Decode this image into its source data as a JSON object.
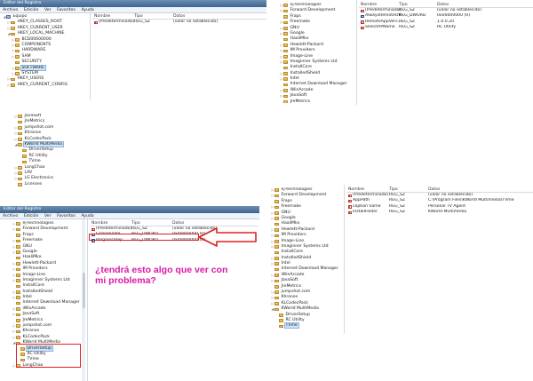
{
  "app": {
    "title": "Editor del Registro",
    "menu": [
      "Archivo",
      "Edición",
      "Ver",
      "Favoritos",
      "Ayuda"
    ]
  },
  "columns": {
    "name": "Nombre",
    "type": "Tipo",
    "data": "Datos"
  },
  "panel1": {
    "tree": [
      {
        "label": "Equipo",
        "level": 0,
        "icon": "computer",
        "expander": "◢"
      },
      {
        "label": "HKEY_CLASSES_ROOT",
        "level": 1,
        "icon": "folder",
        "expander": "▷"
      },
      {
        "label": "HKEY_CURRENT_USER",
        "level": 1,
        "icon": "folder",
        "expander": "▷"
      },
      {
        "label": "HKEY_LOCAL_MACHINE",
        "level": 1,
        "icon": "folder",
        "expander": "◢"
      },
      {
        "label": "BCD00000000",
        "level": 2,
        "icon": "folder",
        "expander": "▷"
      },
      {
        "label": "COMPONENTS",
        "level": 2,
        "icon": "folder",
        "expander": "▷"
      },
      {
        "label": "HARDWARE",
        "level": 2,
        "icon": "folder",
        "expander": "▷"
      },
      {
        "label": "SAM",
        "level": 2,
        "icon": "folder",
        "expander": "▷"
      },
      {
        "label": "SECURITY",
        "level": 2,
        "icon": "folder",
        "expander": ""
      },
      {
        "label": "SOFTWARE",
        "level": 2,
        "icon": "folder",
        "expander": "▷",
        "selected": true
      },
      {
        "label": "SYSTEM",
        "level": 2,
        "icon": "folder",
        "expander": "▷"
      },
      {
        "label": "HKEY_USERS",
        "level": 1,
        "icon": "folder",
        "expander": "▷"
      },
      {
        "label": "HKEY_CURRENT_CONFIG",
        "level": 1,
        "icon": "folder",
        "expander": "▷"
      }
    ],
    "values": [
      {
        "name": "(Predeterminado)",
        "type": "REG_SZ",
        "data": "(valor no establecido)",
        "kind": "sz"
      }
    ]
  },
  "panel2": {
    "tree": [
      {
        "label": "ej-technologies",
        "level": 0,
        "expander": "▷"
      },
      {
        "label": "Forward Development",
        "level": 0,
        "expander": "▷"
      },
      {
        "label": "Fraps",
        "level": 0,
        "expander": ""
      },
      {
        "label": "Freemake",
        "level": 0,
        "expander": "▷"
      },
      {
        "label": "GNU",
        "level": 0,
        "expander": "▷"
      },
      {
        "label": "Google",
        "level": 0,
        "expander": "▷"
      },
      {
        "label": "HaaliMkx",
        "level": 0,
        "expander": ""
      },
      {
        "label": "Hewlett-Packard",
        "level": 0,
        "expander": "▷"
      },
      {
        "label": "IM Providers",
        "level": 0,
        "expander": "▷"
      },
      {
        "label": "Image-Line",
        "level": 0,
        "expander": "▷"
      },
      {
        "label": "Imaginner Systems Ltd",
        "level": 0,
        "expander": "▷"
      },
      {
        "label": "InstallCore",
        "level": 0,
        "expander": ""
      },
      {
        "label": "InstalledShield",
        "level": 0,
        "expander": "▷"
      },
      {
        "label": "Intel",
        "level": 0,
        "expander": "▷"
      },
      {
        "label": "Internet Download Manager",
        "level": 0,
        "expander": ""
      },
      {
        "label": "iWinArcade",
        "level": 0,
        "expander": "▷"
      },
      {
        "label": "JavaSoft",
        "level": 0,
        "expander": "▷"
      },
      {
        "label": "JreMetrics",
        "level": 0,
        "expander": ""
      },
      {
        "label": "jumpshot.com",
        "level": 0,
        "expander": "▷"
      },
      {
        "label": "Khronos",
        "level": 0,
        "expander": "▷"
      },
      {
        "label": "KLCodecPack",
        "level": 0,
        "expander": "▷"
      },
      {
        "label": "KWorld MultiMedia",
        "level": 0,
        "expander": "◢"
      },
      {
        "label": "DriverSetup",
        "level": 1,
        "expander": ""
      },
      {
        "label": "RC Utility",
        "level": 1,
        "expander": "",
        "selected": true
      },
      {
        "label": "TVme",
        "level": 1,
        "expander": ""
      }
    ],
    "values": [
      {
        "name": "(Predeterminado)",
        "type": "REG_SZ",
        "data": "(valor no establecido)",
        "kind": "sz"
      },
      {
        "name": "AlwaysRemoteOff",
        "type": "REG_DWORD",
        "data": "0x00000000 (0)",
        "kind": "dw"
      },
      {
        "name": "RemoteAppVers...",
        "type": "REG_SZ",
        "data": "1.0.0.20",
        "kind": "sz"
      },
      {
        "name": "SelectAPName",
        "type": "REG_SZ",
        "data": "RC Utility",
        "kind": "sz"
      }
    ]
  },
  "panel3": {
    "tree": [
      {
        "label": "JavaSoft",
        "level": 0,
        "expander": "▷"
      },
      {
        "label": "JreMetrics",
        "level": 0,
        "expander": ""
      },
      {
        "label": "jumpshot.com",
        "level": 0,
        "expander": "▷"
      },
      {
        "label": "Khronos",
        "level": 0,
        "expander": "▷"
      },
      {
        "label": "KLCodecPack",
        "level": 0,
        "expander": "▷"
      },
      {
        "label": "KWorld MultiMedia",
        "level": 0,
        "expander": "◢",
        "selected": true
      },
      {
        "label": "DriverSetup",
        "level": 1,
        "expander": ""
      },
      {
        "label": "RC Utility",
        "level": 1,
        "expander": ""
      },
      {
        "label": "TVme",
        "level": 1,
        "expander": ""
      },
      {
        "label": "LangChao",
        "level": 0,
        "expander": "▷"
      },
      {
        "label": "LAV",
        "level": 0,
        "expander": "▷"
      },
      {
        "label": "LG Electronics",
        "level": 0,
        "expander": "▷"
      },
      {
        "label": "Licenses",
        "level": 0,
        "expander": ""
      }
    ]
  },
  "panel4": {
    "tree": [
      {
        "label": "ej-technologies",
        "level": 0,
        "expander": "▷"
      },
      {
        "label": "Forward Development",
        "level": 0,
        "expander": "▷"
      },
      {
        "label": "Fraps",
        "level": 0,
        "expander": ""
      },
      {
        "label": "Freemake",
        "level": 0,
        "expander": "▷"
      },
      {
        "label": "GNU",
        "level": 0,
        "expander": "▷"
      },
      {
        "label": "Google",
        "level": 0,
        "expander": "▷"
      },
      {
        "label": "HaaliMkx",
        "level": 0,
        "expander": ""
      },
      {
        "label": "Hewlett-Packard",
        "level": 0,
        "expander": "▷"
      },
      {
        "label": "IM Providers",
        "level": 0,
        "expander": "▷"
      },
      {
        "label": "Image-Line",
        "level": 0,
        "expander": "▷"
      },
      {
        "label": "Imaginner Systems Ltd",
        "level": 0,
        "expander": "▷"
      },
      {
        "label": "InstallCore",
        "level": 0,
        "expander": ""
      },
      {
        "label": "InstalledShield",
        "level": 0,
        "expander": "▷"
      },
      {
        "label": "Intel",
        "level": 0,
        "expander": "▷"
      },
      {
        "label": "Internet Download Manager",
        "level": 0,
        "expander": ""
      },
      {
        "label": "iWinArcade",
        "level": 0,
        "expander": "▷"
      },
      {
        "label": "JavaSoft",
        "level": 0,
        "expander": "▷"
      },
      {
        "label": "JreMetrics",
        "level": 0,
        "expander": ""
      },
      {
        "label": "jumpshot.com",
        "level": 0,
        "expander": "▷"
      },
      {
        "label": "Khronos",
        "level": 0,
        "expander": "▷"
      },
      {
        "label": "KLCodecPack",
        "level": 0,
        "expander": "▷"
      },
      {
        "label": "KWorld MultiMedia",
        "level": 0,
        "expander": "◢"
      },
      {
        "label": "DriverSetup",
        "level": 1,
        "expander": "",
        "selected": true
      },
      {
        "label": "RC Utility",
        "level": 1,
        "expander": ""
      },
      {
        "label": "TVme",
        "level": 1,
        "expander": ""
      },
      {
        "label": "LangChao",
        "level": 0,
        "expander": "▷"
      }
    ],
    "values": [
      {
        "name": "(Predeterminado)",
        "type": "REG_SZ",
        "data": "(valor no establecido)",
        "kind": "sz"
      },
      {
        "name": "ErrorHandle",
        "type": "REG_DWORD",
        "data": "0x00000000 (0)",
        "kind": "dw",
        "highlighted": true
      },
      {
        "name": "ProgressStep",
        "type": "REG_DWORD",
        "data": "0x00000000 (0)",
        "kind": "dw"
      }
    ]
  },
  "panel5": {
    "tree": [
      {
        "label": "ej-technologies",
        "level": 0,
        "expander": "▷"
      },
      {
        "label": "Forward Development",
        "level": 0,
        "expander": "▷"
      },
      {
        "label": "Fraps",
        "level": 0,
        "expander": ""
      },
      {
        "label": "Freemake",
        "level": 0,
        "expander": "▷"
      },
      {
        "label": "GNU",
        "level": 0,
        "expander": "▷"
      },
      {
        "label": "Google",
        "level": 0,
        "expander": "▷"
      },
      {
        "label": "HaaliMkx",
        "level": 0,
        "expander": ""
      },
      {
        "label": "Hewlett-Packard",
        "level": 0,
        "expander": "▷"
      },
      {
        "label": "IM Providers",
        "level": 0,
        "expander": "▷"
      },
      {
        "label": "Image-Line",
        "level": 0,
        "expander": "▷"
      },
      {
        "label": "Imaginner Systems Ltd",
        "level": 0,
        "expander": "▷"
      },
      {
        "label": "InstallCore",
        "level": 0,
        "expander": ""
      },
      {
        "label": "InstalledShield",
        "level": 0,
        "expander": "▷"
      },
      {
        "label": "Intel",
        "level": 0,
        "expander": "▷"
      },
      {
        "label": "Internet Download Manager",
        "level": 0,
        "expander": ""
      },
      {
        "label": "iWinArcade",
        "level": 0,
        "expander": "▷"
      },
      {
        "label": "JavaSoft",
        "level": 0,
        "expander": "▷"
      },
      {
        "label": "JreMetrics",
        "level": 0,
        "expander": ""
      },
      {
        "label": "jumpshot.com",
        "level": 0,
        "expander": "▷"
      },
      {
        "label": "Khronos",
        "level": 0,
        "expander": "▷"
      },
      {
        "label": "KLCodecPack",
        "level": 0,
        "expander": "▷"
      },
      {
        "label": "KWorld MultiMedia",
        "level": 0,
        "expander": "◢"
      },
      {
        "label": "DriverSetup",
        "level": 1,
        "expander": ""
      },
      {
        "label": "RC Utility",
        "level": 1,
        "expander": ""
      },
      {
        "label": "TVme",
        "level": 1,
        "expander": "",
        "selected": true
      }
    ],
    "values": [
      {
        "name": "(Predeterminado)",
        "type": "REG_SZ",
        "data": "(valor no establecido)",
        "kind": "sz"
      },
      {
        "name": "AppPath",
        "type": "REG_SZ",
        "data": "C:\\Program Files\\KWorld Multimedia\\TVme",
        "kind": "sz"
      },
      {
        "name": "caption name",
        "type": "REG_SZ",
        "data": "Personal TV Agent",
        "kind": "sz"
      },
      {
        "name": "InstallFolder",
        "type": "REG_SZ",
        "data": "KWorld Multimedia",
        "kind": "sz"
      }
    ]
  },
  "annotation": {
    "question": "¿tendrá esto algo que ver con mi problema?",
    "color": "#d81aa6",
    "highlight_color": "#e02020"
  }
}
